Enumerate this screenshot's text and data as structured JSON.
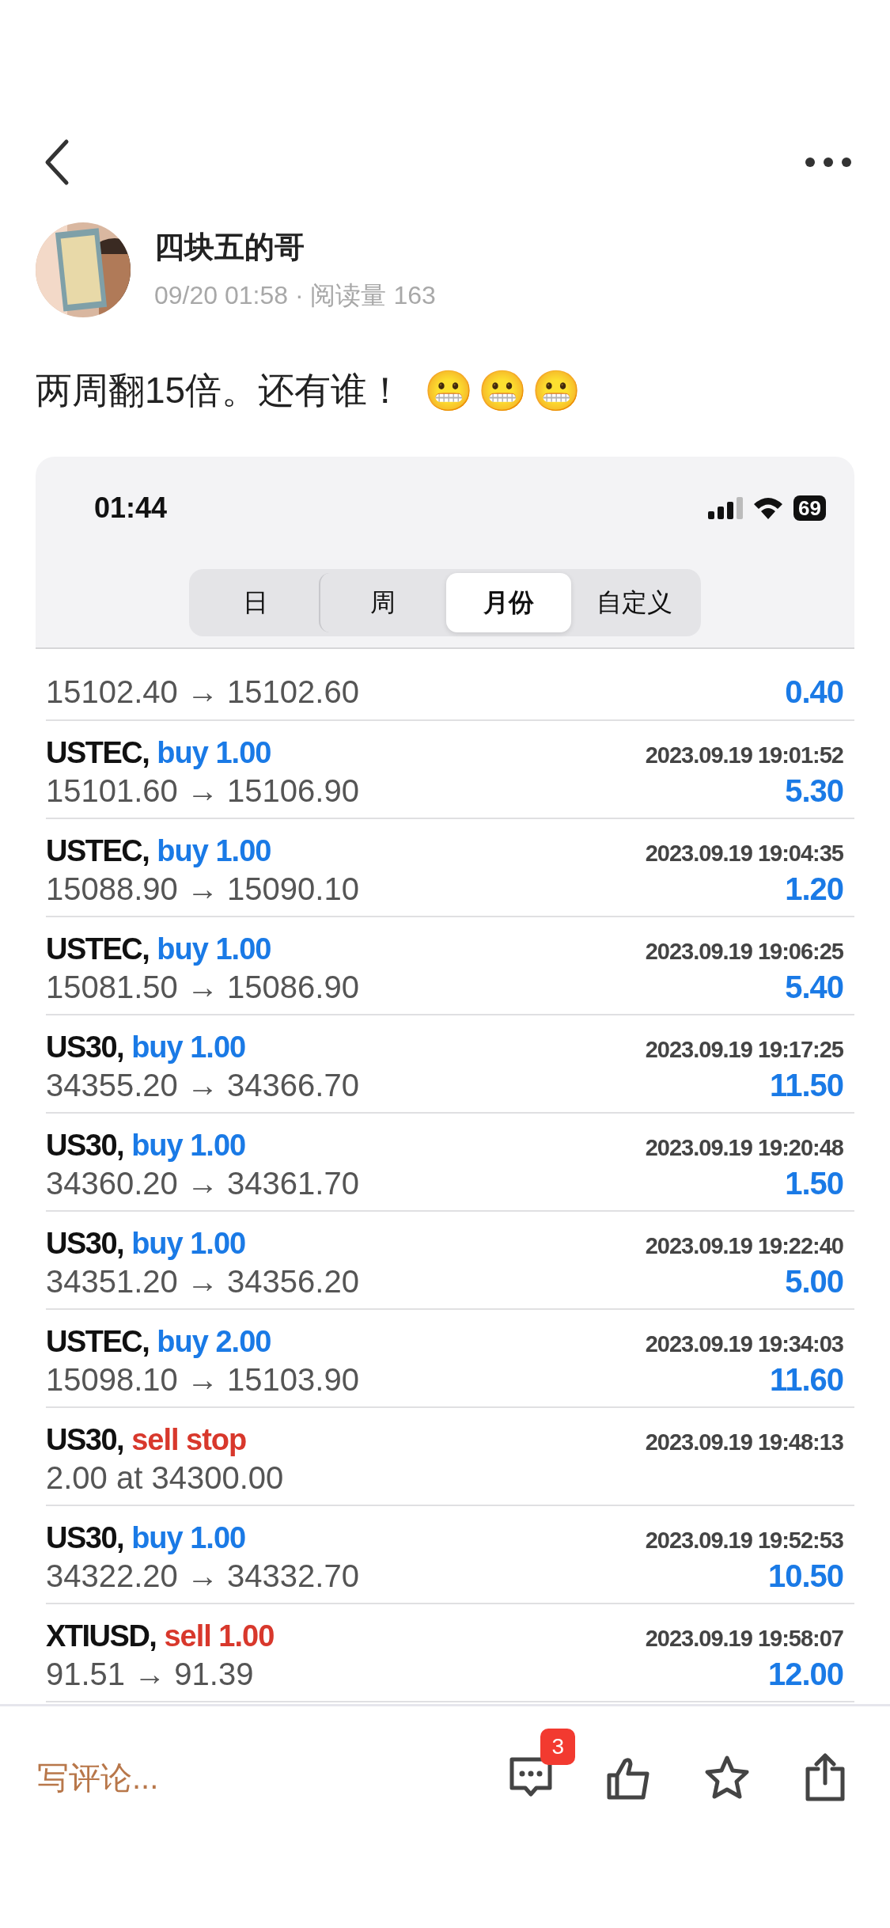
{
  "author": {
    "name": "四块五的哥",
    "meta": "09/20 01:58 · 阅读量 163"
  },
  "post": {
    "text": "两周翻15倍。还有谁！",
    "emojis": [
      "😬",
      "😬",
      "😬"
    ]
  },
  "screenshot": {
    "status_bar": {
      "time": "01:44",
      "battery": "69"
    },
    "tabs": [
      {
        "label": "日",
        "selected": false
      },
      {
        "label": "周",
        "selected": false
      },
      {
        "label": "月份",
        "selected": true
      },
      {
        "label": "自定义",
        "selected": false
      }
    ],
    "trades": [
      {
        "prices": "15102.40 → 15102.60",
        "profit": "0.40"
      },
      {
        "symbol": "USTEC,",
        "side": "buy 1.00",
        "kind": "buy",
        "time": "2023.09.19 19:01:52",
        "prices": "15101.60 → 15106.90",
        "profit": "5.30"
      },
      {
        "symbol": "USTEC,",
        "side": "buy 1.00",
        "kind": "buy",
        "time": "2023.09.19 19:04:35",
        "prices": "15088.90 → 15090.10",
        "profit": "1.20"
      },
      {
        "symbol": "USTEC,",
        "side": "buy 1.00",
        "kind": "buy",
        "time": "2023.09.19 19:06:25",
        "prices": "15081.50 → 15086.90",
        "profit": "5.40"
      },
      {
        "symbol": "US30,",
        "side": "buy 1.00",
        "kind": "buy",
        "time": "2023.09.19 19:17:25",
        "prices": "34355.20 → 34366.70",
        "profit": "11.50"
      },
      {
        "symbol": "US30,",
        "side": "buy 1.00",
        "kind": "buy",
        "time": "2023.09.19 19:20:48",
        "prices": "34360.20 → 34361.70",
        "profit": "1.50"
      },
      {
        "symbol": "US30,",
        "side": "buy 1.00",
        "kind": "buy",
        "time": "2023.09.19 19:22:40",
        "prices": "34351.20 → 34356.20",
        "profit": "5.00"
      },
      {
        "symbol": "USTEC,",
        "side": "buy 2.00",
        "kind": "buy",
        "time": "2023.09.19 19:34:03",
        "prices": "15098.10 → 15103.90",
        "profit": "11.60"
      },
      {
        "symbol": "US30,",
        "side": "sell stop",
        "kind": "sell",
        "time": "2023.09.19 19:48:13",
        "prices": "2.00 at 34300.00"
      },
      {
        "symbol": "US30,",
        "side": "buy 1.00",
        "kind": "buy",
        "time": "2023.09.19 19:52:53",
        "prices": "34322.20 → 34332.70",
        "profit": "10.50"
      },
      {
        "symbol": "XTIUSD,",
        "side": "sell 1.00",
        "kind": "sell",
        "time": "2023.09.19 19:58:07",
        "prices": "91.51 → 91.39",
        "profit": "12.00"
      }
    ]
  },
  "bottom_bar": {
    "comment_placeholder": "写评论...",
    "comment_count": "3"
  }
}
